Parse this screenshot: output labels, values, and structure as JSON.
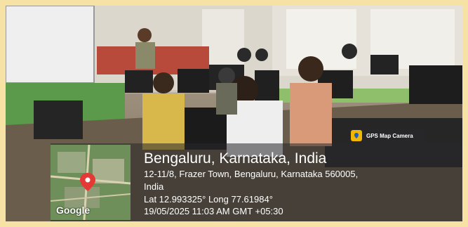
{
  "overlay": {
    "app_badge": "GPS Map Camera",
    "map_brand": "Google",
    "location_title": "Bengaluru, Karnataka, India",
    "address_line1": "12-11/8, Frazer Town, Bengaluru, Karnataka 560005,",
    "address_line2": "India",
    "coordinates": "Lat 12.993325° Long 77.61984°",
    "timestamp": "19/05/2025 11:03 AM GMT +05:30"
  },
  "colors": {
    "border": "#f7e2a6",
    "overlay_bg": "#28282c",
    "badge_accent": "#f2b705",
    "map_pin": "#e53935"
  },
  "icons": {
    "badge_logo": "gps-map-camera-icon",
    "map_pin": "location-pin-icon"
  }
}
